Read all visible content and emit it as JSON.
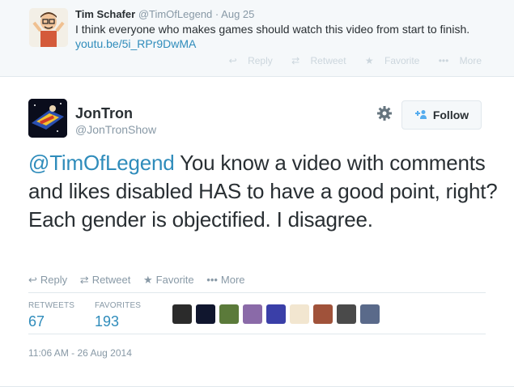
{
  "parent_tweet": {
    "name": "Tim Schafer",
    "handle": "@TimOfLegend",
    "time": "Aug 25",
    "text": "I think everyone who makes games should watch this video from start to finish.",
    "link": "youtu.be/5i_RPr9DwMA",
    "actions": {
      "reply": "Reply",
      "retweet": "Retweet",
      "favorite": "Favorite",
      "more": "More"
    }
  },
  "tweet": {
    "name": "JonTron",
    "handle": "@JonTronShow",
    "follow_label": "Follow",
    "mention": "@TimOfLegend",
    "text": " You know a video with comments and likes disabled HAS to have a good point, right?  Each gender is objectified.  I disagree.",
    "actions": {
      "reply": "Reply",
      "retweet": "Retweet",
      "favorite": "Favorite",
      "more": "More"
    },
    "stats": {
      "retweets_label": "RETWEETS",
      "retweets": "67",
      "favorites_label": "FAVORITES",
      "favorites": "193"
    },
    "date": "11:06 AM - 26 Aug 2014"
  },
  "colors": {
    "link": "#2f8cbb",
    "muted": "#8899a6",
    "text": "#292f33",
    "follow_icon": "#55acee"
  }
}
